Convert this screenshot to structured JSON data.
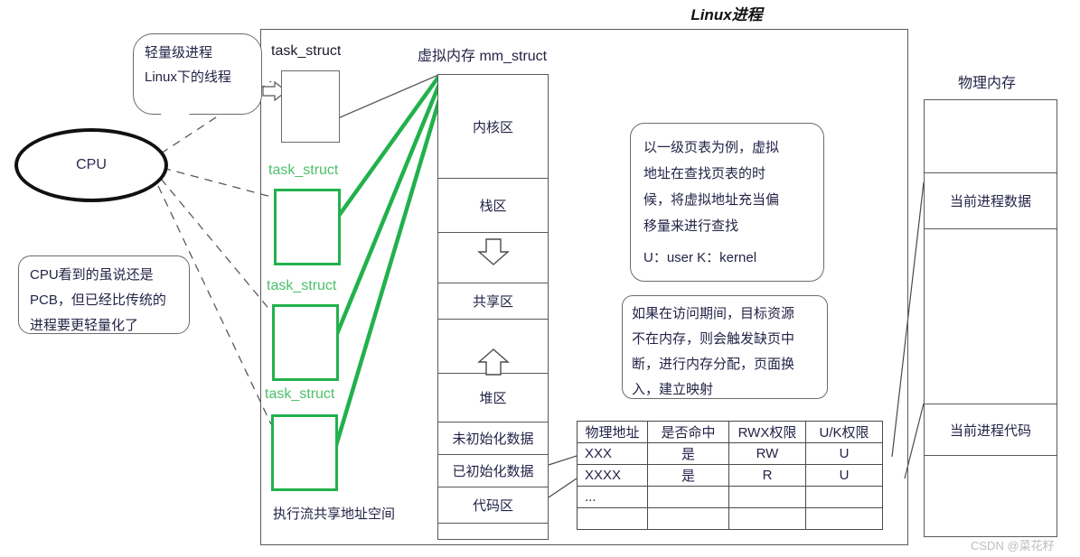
{
  "title": "Linux进程",
  "watermark": "CSDN @菜花籽",
  "cpu": {
    "label": "CPU"
  },
  "callouts": {
    "lwp": {
      "line1": "轻量级进程",
      "line2": "Linux下的线程"
    },
    "pcb": {
      "line1": "CPU看到的虽说还是",
      "line2": "PCB，但已经比传统的",
      "line3": "进程要更轻量化了"
    },
    "page_table": {
      "line1": "以一级页表为例，虚拟",
      "line2": "地址在查找页表的时",
      "line3": "候，将虚拟地址充当偏",
      "line4": "移量来进行查找",
      "line5": "U：user  K：kernel"
    },
    "page_fault": {
      "line1": "如果在访问期间，目标资源",
      "line2": "不在内存，则会触发缺页中",
      "line3": "断，进行内存分配，页面换",
      "line4": "入，建立映射"
    }
  },
  "task_structs": [
    {
      "label": "task_struct",
      "style": "black"
    },
    {
      "label": "task_struct",
      "style": "green"
    },
    {
      "label": "task_struct",
      "style": "green"
    },
    {
      "label": "task_struct",
      "style": "green"
    }
  ],
  "flow_label": "执行流共享地址空间",
  "mm_struct": {
    "title": "虚拟内存 mm_struct",
    "regions": [
      {
        "label": "内核区"
      },
      {
        "label": "栈区"
      },
      {
        "label": ""
      },
      {
        "label": "共享区"
      },
      {
        "label": ""
      },
      {
        "label": "堆区"
      },
      {
        "label": "未初始化数据"
      },
      {
        "label": "已初始化数据"
      },
      {
        "label": "代码区"
      },
      {
        "label": ""
      }
    ]
  },
  "page_table": {
    "headers": [
      "物理地址",
      "是否命中",
      "RWX权限",
      "U/K权限"
    ],
    "rows": [
      [
        "XXX",
        "是",
        "RW",
        "U"
      ],
      [
        "XXXX",
        "是",
        "R",
        "U"
      ],
      [
        "...",
        "",
        "",
        ""
      ],
      [
        "",
        "",
        "",
        ""
      ]
    ]
  },
  "physical_memory": {
    "title": "物理内存",
    "blocks": [
      {
        "label": ""
      },
      {
        "label": "当前进程数据"
      },
      {
        "label": ""
      },
      {
        "label": "当前进程代码"
      },
      {
        "label": ""
      }
    ]
  },
  "colors": {
    "green": "#22b14c",
    "green_text": "#4cbf6a",
    "line": "#595959",
    "text": "#232347",
    "watermark": "#bdbdbd"
  }
}
